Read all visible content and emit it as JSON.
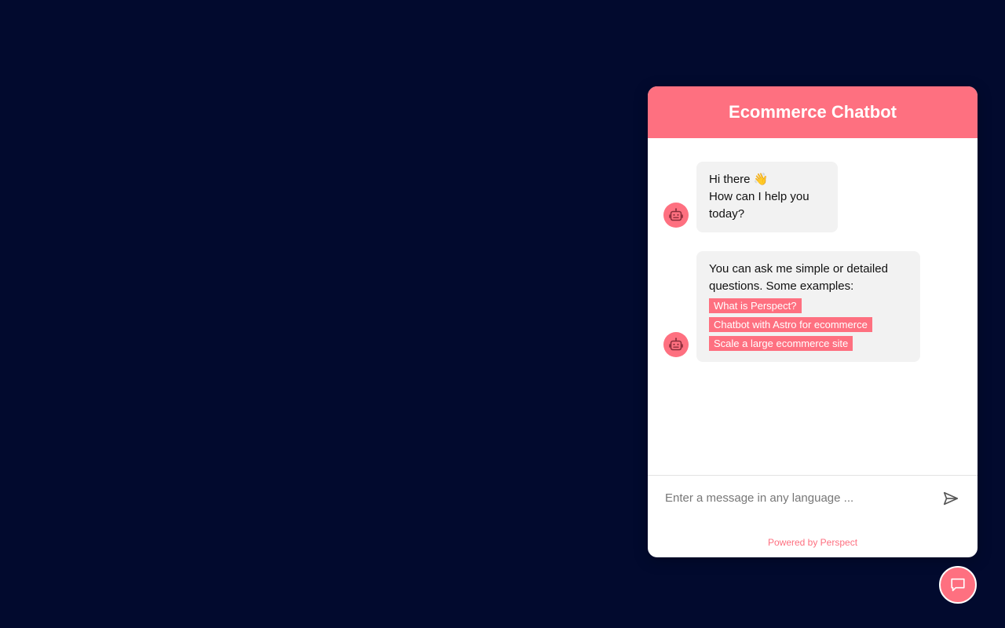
{
  "header": {
    "title": "Ecommerce Chatbot"
  },
  "messages": [
    {
      "sender": "bot",
      "lines": [
        "Hi there 👋",
        "How can I help you today?"
      ]
    },
    {
      "sender": "bot",
      "text": "You can ask me simple or detailed questions. Some examples:",
      "suggestions": [
        "What is Perspect?",
        "Chatbot with Astro for ecommerce",
        "Scale a large ecommerce site"
      ]
    }
  ],
  "input": {
    "placeholder": "Enter a message in any language ...",
    "value": ""
  },
  "footer": {
    "text": "Powered by Perspect"
  },
  "icons": {
    "avatar": "robot-icon",
    "send": "send-icon",
    "launcher": "chat-bubble-icon"
  },
  "colors": {
    "background": "#020a2e",
    "accent": "#fe7080",
    "bubble": "#f2f2f2"
  }
}
